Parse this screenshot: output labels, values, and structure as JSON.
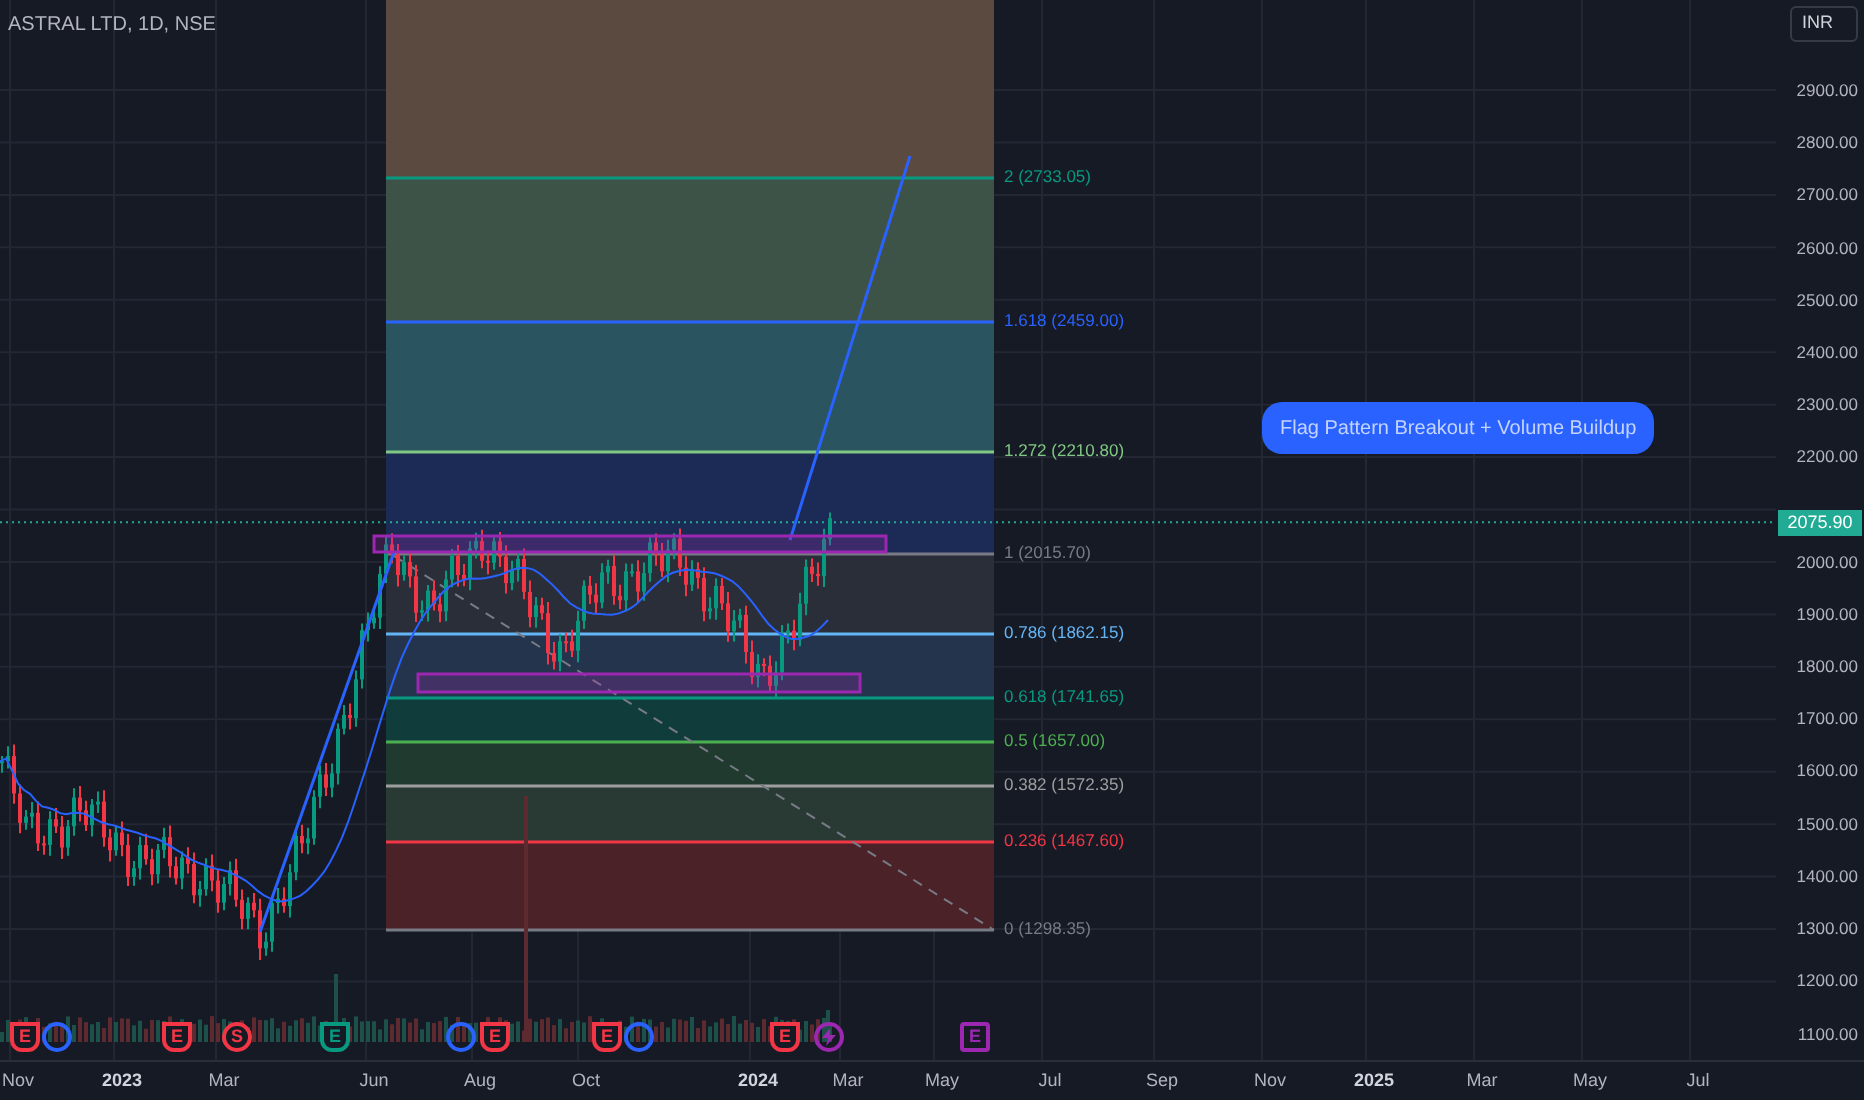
{
  "chart": {
    "title": "ASTRAL LTD, 1D, NSE",
    "currency": "INR",
    "last_price": "2075.90",
    "annotation": "Flag Pattern Breakout + Volume Buildup",
    "fib_levels": [
      {
        "label": "2 (2733.05)",
        "color": "#089981"
      },
      {
        "label": "1.618 (2459.00)",
        "color": "#2962ff"
      },
      {
        "label": "1.272 (2210.80)",
        "color": "#81c784"
      },
      {
        "label": "1 (2015.70)",
        "color": "#787b86"
      },
      {
        "label": "0.786 (1862.15)",
        "color": "#64b5f6"
      },
      {
        "label": "0.618 (1741.65)",
        "color": "#089981"
      },
      {
        "label": "0.5 (1657.00)",
        "color": "#4caf50"
      },
      {
        "label": "0.382 (1572.35)",
        "color": "#9e9e9e"
      },
      {
        "label": "0.236 (1467.60)",
        "color": "#f23645"
      },
      {
        "label": "0 (1298.35)",
        "color": "#787b86"
      }
    ],
    "price_ticks": [
      "2900.00",
      "2800.00",
      "2700.00",
      "2600.00",
      "2500.00",
      "2400.00",
      "2300.00",
      "2200.00",
      "2000.00",
      "1900.00",
      "1800.00",
      "1700.00",
      "1600.00",
      "1500.00",
      "1400.00",
      "1300.00",
      "1200.00",
      "1100.00"
    ],
    "time_ticks": [
      {
        "label": "Nov",
        "kind": "month"
      },
      {
        "label": "2023",
        "kind": "year"
      },
      {
        "label": "Mar",
        "kind": "month"
      },
      {
        "label": "Jun",
        "kind": "month"
      },
      {
        "label": "Aug",
        "kind": "month"
      },
      {
        "label": "Oct",
        "kind": "month"
      },
      {
        "label": "2024",
        "kind": "year"
      },
      {
        "label": "Mar",
        "kind": "month"
      },
      {
        "label": "May",
        "kind": "month"
      },
      {
        "label": "Jul",
        "kind": "month"
      },
      {
        "label": "Sep",
        "kind": "month"
      },
      {
        "label": "Nov",
        "kind": "month"
      },
      {
        "label": "2025",
        "kind": "year"
      },
      {
        "label": "Mar",
        "kind": "month"
      },
      {
        "label": "May",
        "kind": "month"
      },
      {
        "label": "Jul",
        "kind": "month"
      }
    ],
    "events": [
      {
        "kind": "earnings",
        "label": "E",
        "color": "#f23645"
      },
      {
        "kind": "dividend",
        "color": "#2962ff"
      },
      {
        "kind": "earnings",
        "label": "E",
        "color": "#f23645"
      },
      {
        "kind": "split",
        "label": "S",
        "color": "#f23645"
      },
      {
        "kind": "earnings",
        "label": "E",
        "color": "#089981"
      },
      {
        "kind": "dividend",
        "color": "#2962ff"
      },
      {
        "kind": "earnings",
        "label": "E",
        "color": "#f23645"
      },
      {
        "kind": "earnings",
        "label": "E",
        "color": "#f23645"
      },
      {
        "kind": "dividend",
        "color": "#2962ff"
      },
      {
        "kind": "earnings",
        "label": "E",
        "color": "#f23645"
      },
      {
        "kind": "news",
        "color": "#9c27b0"
      },
      {
        "kind": "upcoming",
        "label": "E",
        "color": "#9c27b0"
      }
    ]
  }
}
